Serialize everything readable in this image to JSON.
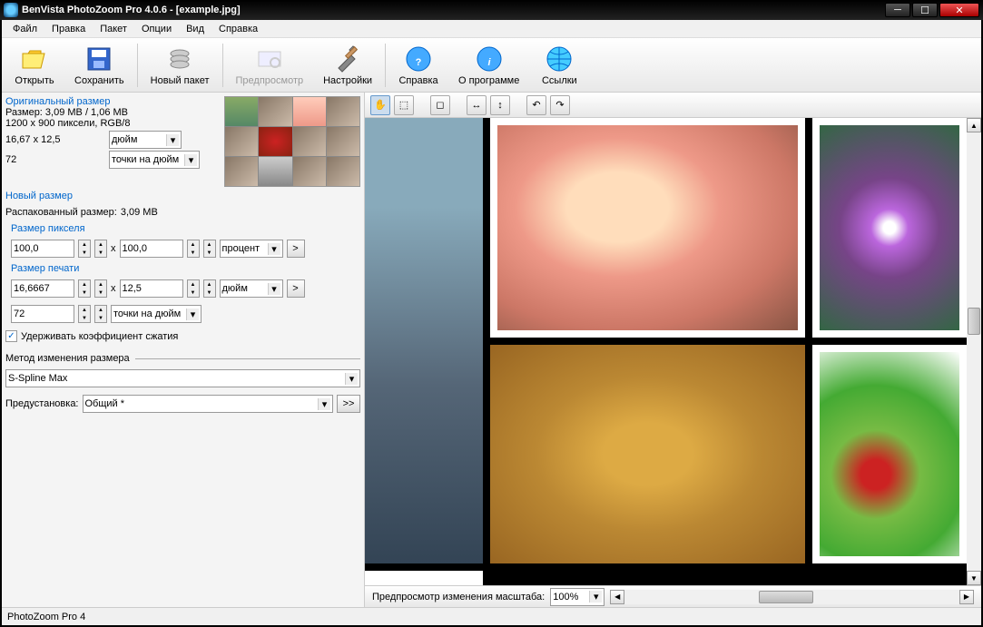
{
  "title": "BenVista PhotoZoom Pro 4.0.6 - [example.jpg]",
  "menu": {
    "file": "Файл",
    "edit": "Правка",
    "batch": "Пакет",
    "options": "Опции",
    "view": "Вид",
    "help": "Справка"
  },
  "toolbar": {
    "open": "Открыть",
    "save": "Сохранить",
    "newbatch": "Новый пакет",
    "preview": "Предпросмотр",
    "settings": "Настройки",
    "help": "Справка",
    "about": "О программе",
    "links": "Ссылки"
  },
  "orig": {
    "title": "Оригинальный размер",
    "size_label": "Размер: 3,09 MB / 1,06 MB",
    "dims": "1200 x 900 пиксели, RGB/8",
    "phys": "16,67 x 12,5",
    "phys_unit": "дюйм",
    "res": "72",
    "res_unit": "точки на дюйм"
  },
  "newsize": {
    "title": "Новый размер",
    "unpacked": "Распакованный размер:",
    "unpacked_val": "3,09 MB",
    "pixel_title": "Размер пикселя",
    "w": "100,0",
    "h": "100,0",
    "unit": "процент",
    "print_title": "Размер печати",
    "pw": "16,6667",
    "ph": "12,5",
    "punit": "дюйм",
    "res": "72",
    "res_unit": "точки на дюйм",
    "keep_ratio": "Удерживать коэффициент сжатия"
  },
  "resize": {
    "title": "Метод изменения размера",
    "method": "S-Spline Max",
    "preset_label": "Предустановка:",
    "preset": "Общий *",
    "more": ">>"
  },
  "zoom": {
    "label": "Предпросмотр изменения масштаба:",
    "value": "100%"
  },
  "status": "PhotoZoom Pro 4",
  "x": "x"
}
